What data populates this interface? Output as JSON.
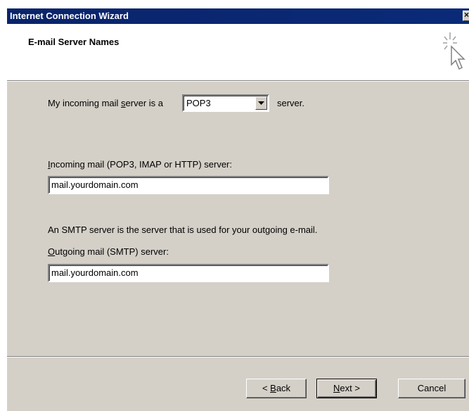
{
  "window": {
    "title": "Internet Connection Wizard",
    "close_label": "×"
  },
  "header": {
    "title": "E-mail Server Names",
    "icon": "wizard-cursor-sparkle-icon"
  },
  "incoming_type": {
    "prefix_before_u": "My incoming mail ",
    "prefix_u": "s",
    "prefix_after_u": "erver is a",
    "selected": "POP3",
    "suffix": "server."
  },
  "incoming_server": {
    "label_u": "I",
    "label_rest": "ncoming mail (POP3, IMAP or HTTP) server:",
    "value": "mail.yourdomain.com"
  },
  "smtp_note": "An SMTP server is the server that is used for your outgoing e-mail.",
  "outgoing_server": {
    "label_u": "O",
    "label_rest": "utgoing mail (SMTP) server:",
    "value": "mail.yourdomain.com"
  },
  "buttons": {
    "back_prefix": "< ",
    "back_u": "B",
    "back_rest": "ack",
    "next_u": "N",
    "next_rest": "ext >",
    "cancel": "Cancel"
  },
  "colors": {
    "titlebar": "#0a246a",
    "dialog_face": "#d4d0c8"
  }
}
